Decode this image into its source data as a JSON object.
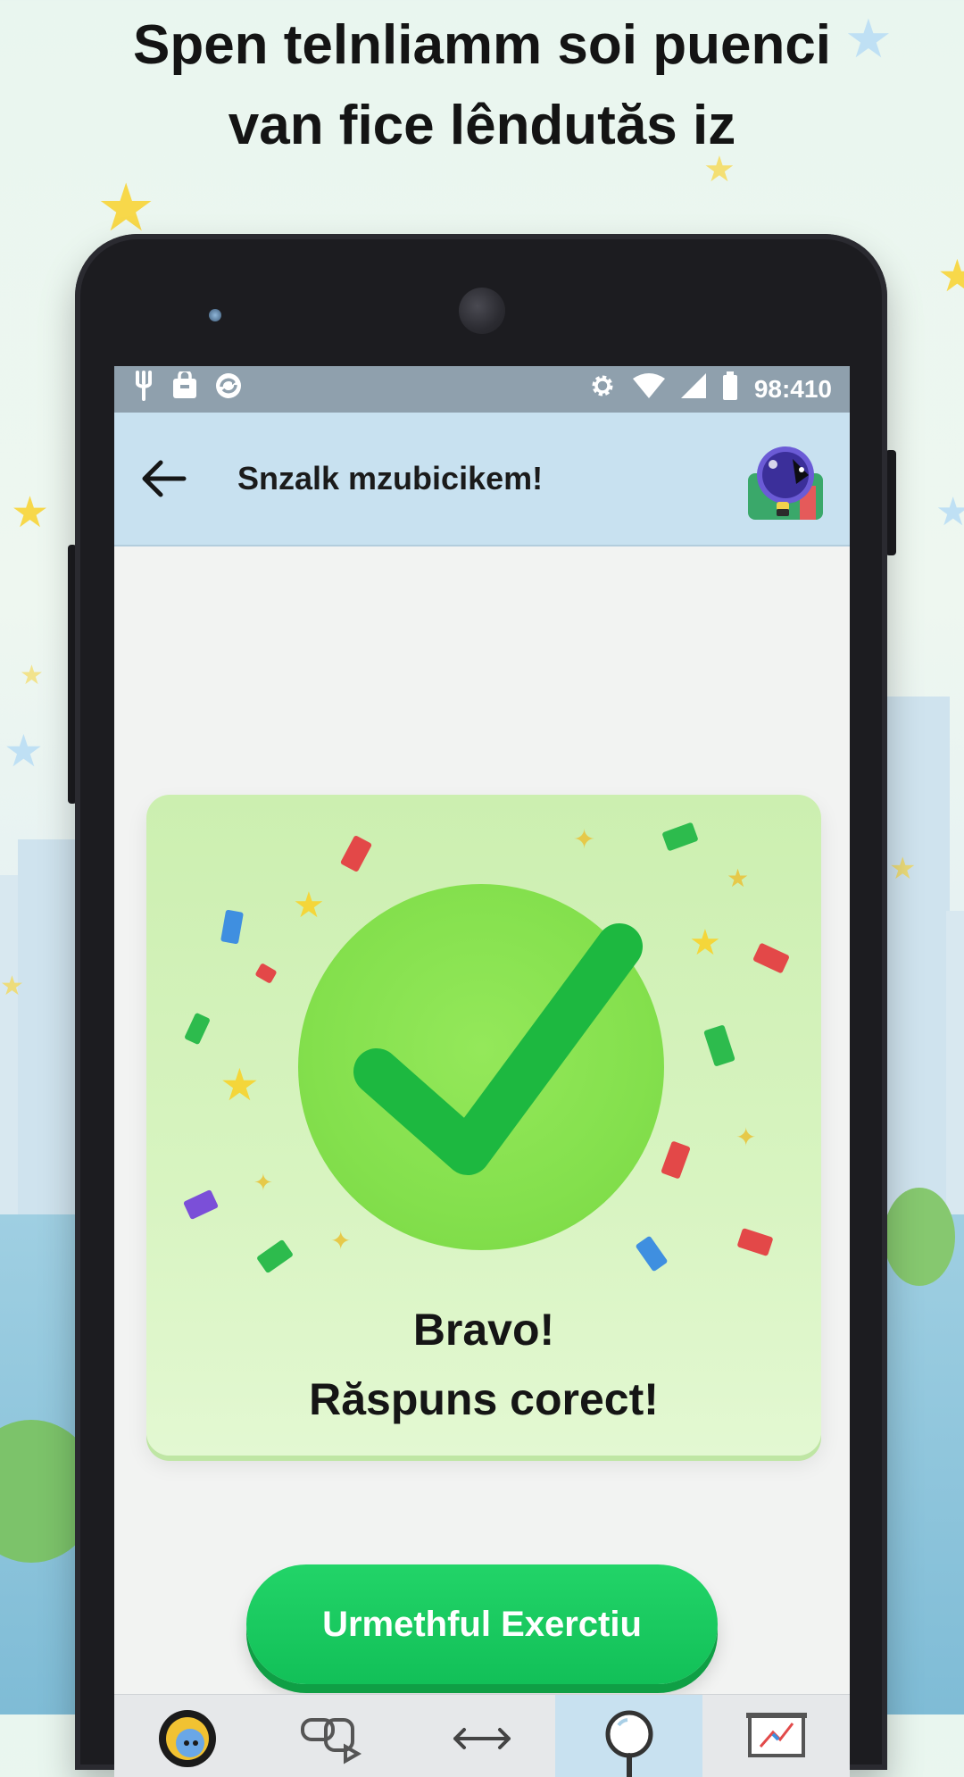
{
  "headline": {
    "line1": "Spen telnliamm soi puenci",
    "line2": "van fice lêndutăs iz"
  },
  "status_bar": {
    "time": "98:410",
    "left_icons": [
      "fork-icon",
      "bag-icon",
      "sync-icon"
    ],
    "right_icons": [
      "gear-icon",
      "wifi-icon",
      "signal-icon",
      "battery-icon"
    ]
  },
  "app_bar": {
    "title": "Snzalk mzubicikem!"
  },
  "result_card": {
    "line1": "Bravo!",
    "line2": "Răspuns corect!"
  },
  "next_button": {
    "label": "Urmethful Exerctiu"
  },
  "bottom_nav": {
    "items": [
      {
        "icon": "profile-icon",
        "active": false
      },
      {
        "icon": "shapes-icon",
        "active": false
      },
      {
        "icon": "arrows-icon",
        "active": false
      },
      {
        "icon": "search-icon",
        "active": true
      },
      {
        "icon": "whiteboard-icon",
        "active": false
      }
    ]
  },
  "colors": {
    "accent_green": "#16c85c",
    "app_bar_blue": "#c8e1f0",
    "card_green": "#d2f2b8",
    "check_green": "#1db840"
  }
}
